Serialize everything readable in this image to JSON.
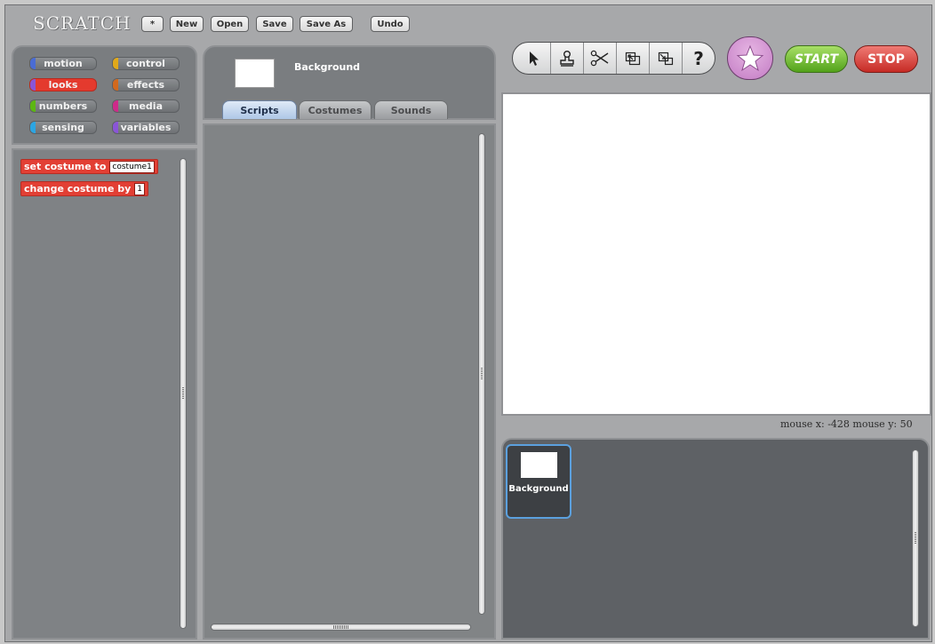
{
  "app": {
    "logo": "SCRATCH"
  },
  "menubar": {
    "items": [
      {
        "label": "*"
      },
      {
        "label": "New"
      },
      {
        "label": "Open"
      },
      {
        "label": "Save"
      },
      {
        "label": "Save As"
      },
      {
        "label": "Undo"
      }
    ]
  },
  "categories": [
    {
      "label": "motion",
      "color": "#4a6cd4"
    },
    {
      "label": "control",
      "color": "#e1a91a"
    },
    {
      "label": "looks",
      "color": "#8a55d7",
      "selected": true
    },
    {
      "label": "effects",
      "color": "#d2691e"
    },
    {
      "label": "numbers",
      "color": "#5cb712"
    },
    {
      "label": "media",
      "color": "#cf2a8a"
    },
    {
      "label": "sensing",
      "color": "#2ca5e2"
    },
    {
      "label": "variables",
      "color": "#8a55d7"
    }
  ],
  "blocks": [
    {
      "label": "set costume to",
      "input": "costume1"
    },
    {
      "label": "change costume by",
      "input": "1"
    }
  ],
  "sprite": {
    "name": "Background"
  },
  "tabs": [
    {
      "label": "Scripts",
      "active": true
    },
    {
      "label": "Costumes"
    },
    {
      "label": "Sounds"
    }
  ],
  "tools": [
    "arrow-icon",
    "stamp-icon",
    "scissors-icon",
    "grow-icon",
    "shrink-icon",
    "help-icon"
  ],
  "controls": {
    "go_label": "START",
    "stop_label": "STOP"
  },
  "mouse": {
    "readout": "mouse x: -428  mouse y: 50"
  },
  "corral": {
    "sprites": [
      {
        "name": "Background"
      }
    ]
  }
}
